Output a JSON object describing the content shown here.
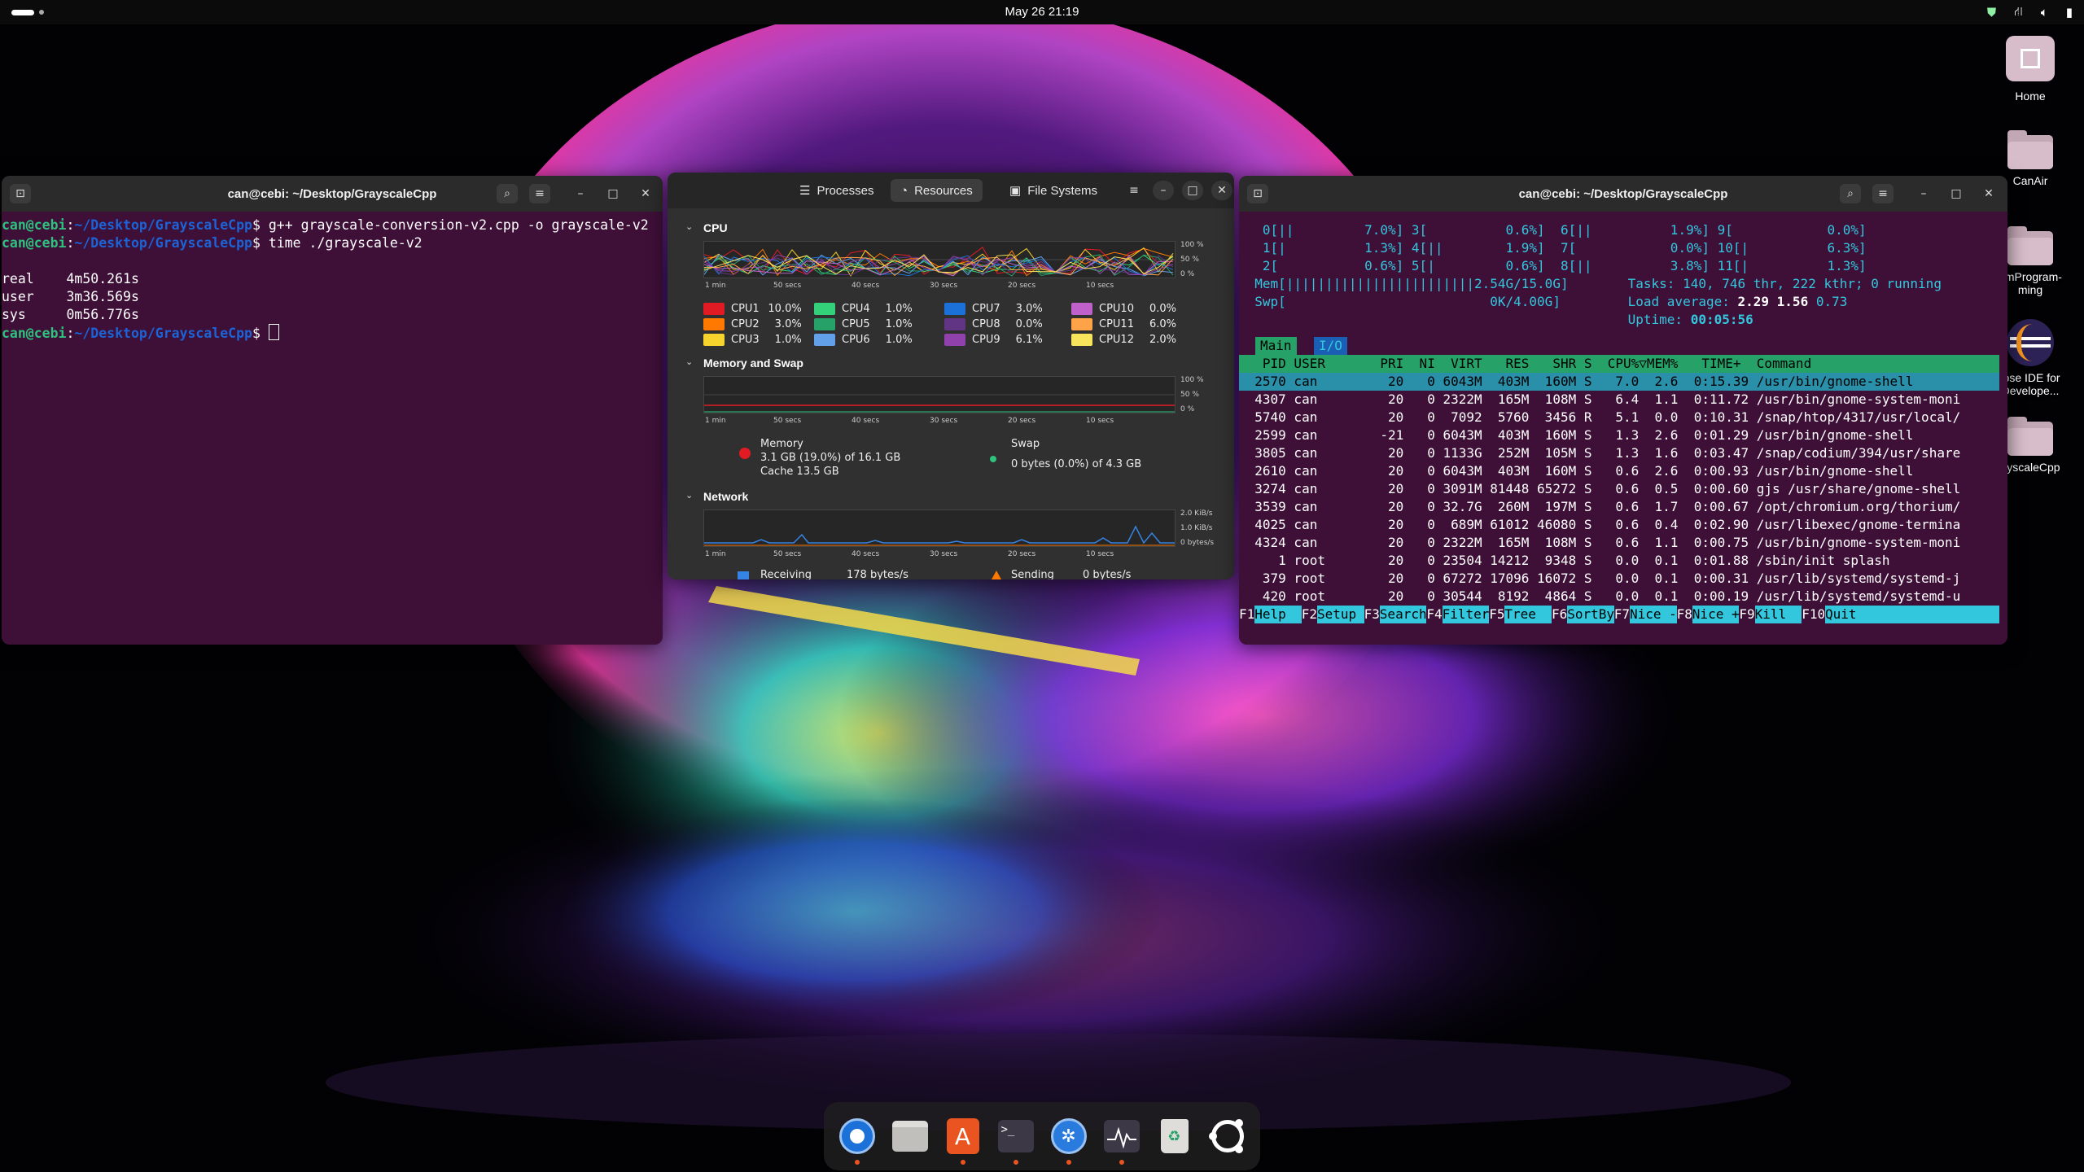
{
  "topbar": {
    "clock": "May 26  21:19"
  },
  "desktop_icons": [
    {
      "label": "Home"
    },
    {
      "label": "CanAir"
    },
    {
      "label": "emProgram-\nming"
    },
    {
      "label": "ipse IDE for\nDevelope..."
    },
    {
      "label": "ayscaleCpp"
    }
  ],
  "terminal1": {
    "title": "can@cebi: ~/Desktop/GrayscaleCpp",
    "prompt_user": "can@cebi",
    "prompt_path": "~/Desktop/GrayscaleCpp",
    "cmd1": " g++ grayscale-conversion-v2.cpp -o grayscale-v2",
    "cmd2": " time ./grayscale-v2",
    "real": "real\t4m50.261s",
    "user": "user\t3m36.569s",
    "sys": "sys\t0m56.776s"
  },
  "sysmon": {
    "tabs": [
      "Processes",
      "Resources",
      "File Systems"
    ],
    "cpu_title": "CPU",
    "y_ticks": [
      "100 %",
      "50 %",
      "0 %"
    ],
    "x_ticks": [
      "1 min",
      "50 secs",
      "40 secs",
      "30 secs",
      "20 secs",
      "10 secs"
    ],
    "cpus": [
      {
        "name": "CPU1",
        "pct": "10.0%",
        "color": "#e01b24"
      },
      {
        "name": "CPU2",
        "pct": "3.0%",
        "color": "#ff7800"
      },
      {
        "name": "CPU3",
        "pct": "1.0%",
        "color": "#f6d32d"
      },
      {
        "name": "CPU4",
        "pct": "1.0%",
        "color": "#33d17a"
      },
      {
        "name": "CPU5",
        "pct": "1.0%",
        "color": "#26a269"
      },
      {
        "name": "CPU6",
        "pct": "1.0%",
        "color": "#62a0ea"
      },
      {
        "name": "CPU7",
        "pct": "3.0%",
        "color": "#1c71d8"
      },
      {
        "name": "CPU8",
        "pct": "0.0%",
        "color": "#613583"
      },
      {
        "name": "CPU9",
        "pct": "6.1%",
        "color": "#9141ac"
      },
      {
        "name": "CPU10",
        "pct": "0.0%",
        "color": "#c061cb"
      },
      {
        "name": "CPU11",
        "pct": "6.0%",
        "color": "#ffa348"
      },
      {
        "name": "CPU12",
        "pct": "2.0%",
        "color": "#f8e45c"
      }
    ],
    "mem_title": "Memory and Swap",
    "memory_label": "Memory",
    "memory_value": "3.1 GB (19.0%) of 16.1 GB",
    "cache_value": "Cache 13.5 GB",
    "swap_label": "Swap",
    "swap_value": "0 bytes (0.0%) of 4.3 GB",
    "net_title": "Network",
    "net_y_ticks": [
      "2.0 KiB/s",
      "1.0 KiB/s",
      "0 bytes/s"
    ],
    "receiving_label": "Receiving",
    "receiving_value": "178 bytes/s",
    "sending_label": "Sending",
    "sending_value": "0 bytes/s"
  },
  "terminal2": {
    "title": "can@cebi: ~/Desktop/GrayscaleCpp",
    "cpu_lines": [
      "   0[||         7.0%] 3[          0.6%]  6[||          1.9%] 9[            0.0%]",
      "   1[|          1.3%] 4[||        1.9%]  7[            0.0%] 10[|          6.3%]",
      "   2[           0.6%] 5[|         0.6%]  8[||          3.8%] 11[|          1.3%]"
    ],
    "mem_line": "  Mem[||||||||||||||||||||||||2.54G/15.0G]",
    "swp_line": "  Swp[                          0K/4.00G]",
    "tasks_line": " Tasks: 140, 746 thr, 222 kthr; 0 running",
    "load_label": " Load average: ",
    "load_value": "2.29 1.56",
    "load_tail": " 0.73",
    "uptime_label": " Uptime: ",
    "uptime_value": "00:05:56",
    "tab_main": "Main",
    "tab_io": "I/O",
    "header": "   PID USER       PRI  NI  VIRT   RES   SHR S  CPU%▽MEM%   TIME+  Command",
    "rows": [
      "  2570 can         20   0 6043M  403M  160M S   7.0  2.6  0:15.39 /usr/bin/gnome-shell",
      "  4307 can         20   0 2322M  165M  108M S   6.4  1.1  0:11.72 /usr/bin/gnome-system-moni",
      "  5740 can         20   0  7092  5760  3456 R   5.1  0.0  0:10.31 /snap/htop/4317/usr/local/",
      "  2599 can        -21   0 6043M  403M  160M S   1.3  2.6  0:01.29 /usr/bin/gnome-shell",
      "  3805 can         20   0 1133G  252M  105M S   1.3  1.6  0:03.47 /snap/codium/394/usr/share",
      "  2610 can         20   0 6043M  403M  160M S   0.6  2.6  0:00.93 /usr/bin/gnome-shell",
      "  3274 can         20   0 3091M 81448 65272 S   0.6  0.5  0:00.60 gjs /usr/share/gnome-shell",
      "  3539 can         20   0 32.7G  260M  197M S   0.6  1.7  0:00.67 /opt/chromium.org/thorium/",
      "  4025 can         20   0  689M 61012 46080 S   0.6  0.4  0:02.90 /usr/libexec/gnome-termina",
      "  4324 can         20   0 2322M  165M  108M S   0.6  1.1  0:00.75 /usr/bin/gnome-system-moni",
      "     1 root        20   0 23504 14212  9348 S   0.0  0.1  0:01.88 /sbin/init splash",
      "   379 root        20   0 67272 17096 16072 S   0.0  0.1  0:00.31 /usr/lib/systemd/systemd-j",
      "   420 root        20   0 30544  8192  4864 S   0.0  0.1  0:00.19 /usr/lib/systemd/systemd-u"
    ],
    "fkeys": [
      {
        "key": "F1",
        "label": "Help  "
      },
      {
        "key": "F2",
        "label": "Setup "
      },
      {
        "key": "F3",
        "label": "Search"
      },
      {
        "key": "F4",
        "label": "Filter"
      },
      {
        "key": "F5",
        "label": "Tree  "
      },
      {
        "key": "F6",
        "label": "SortBy"
      },
      {
        "key": "F7",
        "label": "Nice -"
      },
      {
        "key": "F8",
        "label": "Nice +"
      },
      {
        "key": "F9",
        "label": "Kill  "
      },
      {
        "key": "F10",
        "label": "Quit  "
      }
    ]
  },
  "dock": {
    "apps": [
      "chromium-icon",
      "files-icon",
      "app-center-icon",
      "terminal-icon",
      "codium-icon",
      "system-monitor-icon",
      "trash-icon",
      "ubuntu-icon"
    ]
  }
}
